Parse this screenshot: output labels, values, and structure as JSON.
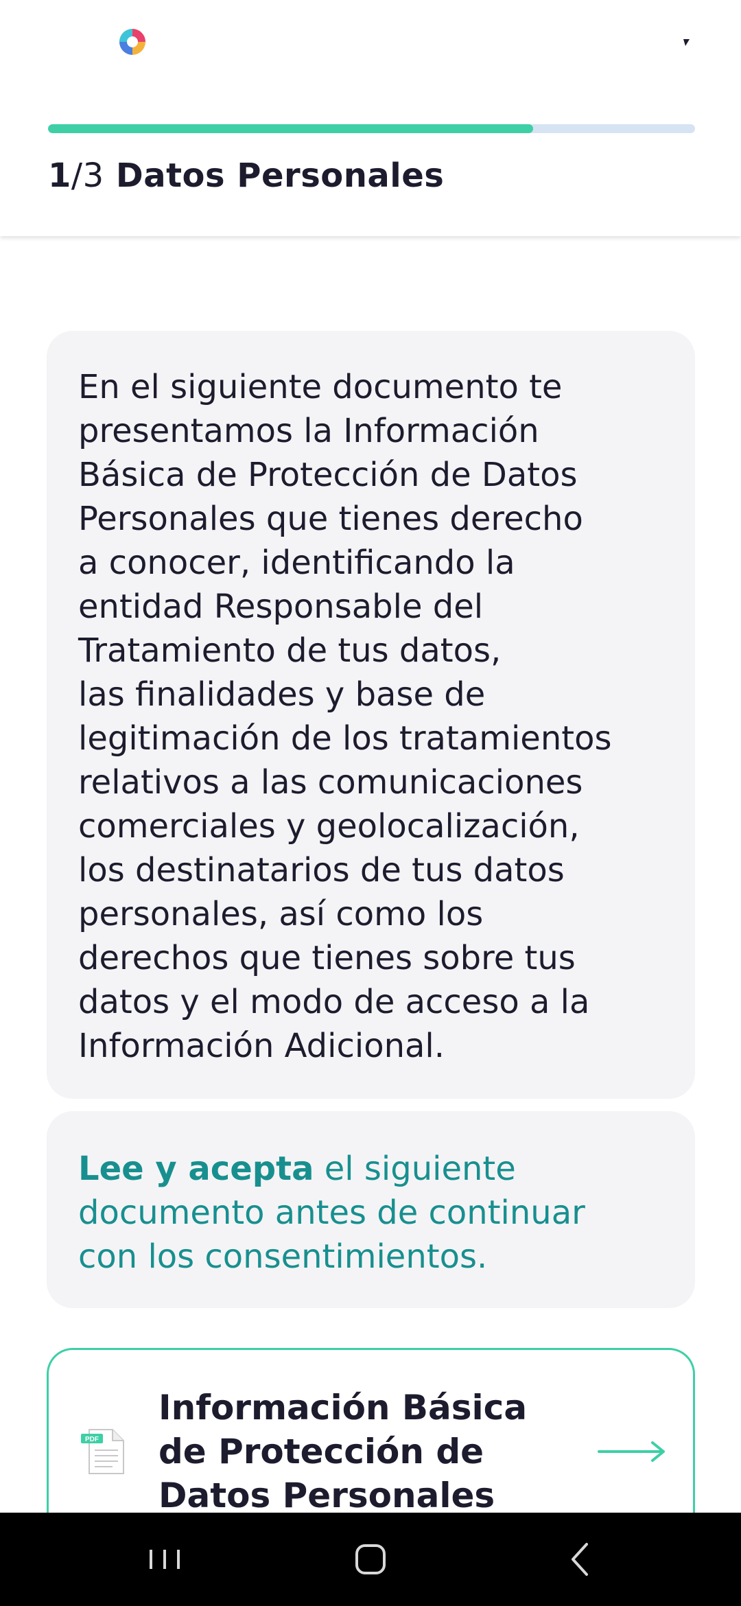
{
  "header": {
    "step_current": "1",
    "step_total": "/3",
    "step_label": "Datos Personales",
    "progress": 0.75,
    "logo_icon": "app-logo-icon",
    "colors": {
      "progress_fill": "#3ecfa6",
      "progress_track": "#d6e3f3"
    }
  },
  "info": {
    "text": "En el siguiente documento te\npresentamos la Información\nBásica de Protección de Datos\nPersonales que tienes derecho\na conocer, identificando la\nentidad Responsable del\nTratamiento de tus datos,\nlas finalidades y base de\nlegitimación de los tratamientos\nrelativos a las comunicaciones\ncomerciales y geolocalización,\nlos destinatarios de tus datos\npersonales, así como los\nderechos que tienes sobre tus\ndatos y el modo de acceso a la\nInformación Adicional."
  },
  "notice": {
    "strong": "Lee y acepta",
    "text": " el siguiente\ndocumento antes de continuar\ncon los consentimientos.",
    "color": "#188f8f"
  },
  "document": {
    "title": "Información Básica\nde Protección de\nDatos Personales",
    "icon": "pdf-file-icon",
    "pdf_label": "PDF"
  },
  "navbar": {
    "icons": [
      "recent-apps-icon",
      "home-icon",
      "back-icon"
    ]
  }
}
